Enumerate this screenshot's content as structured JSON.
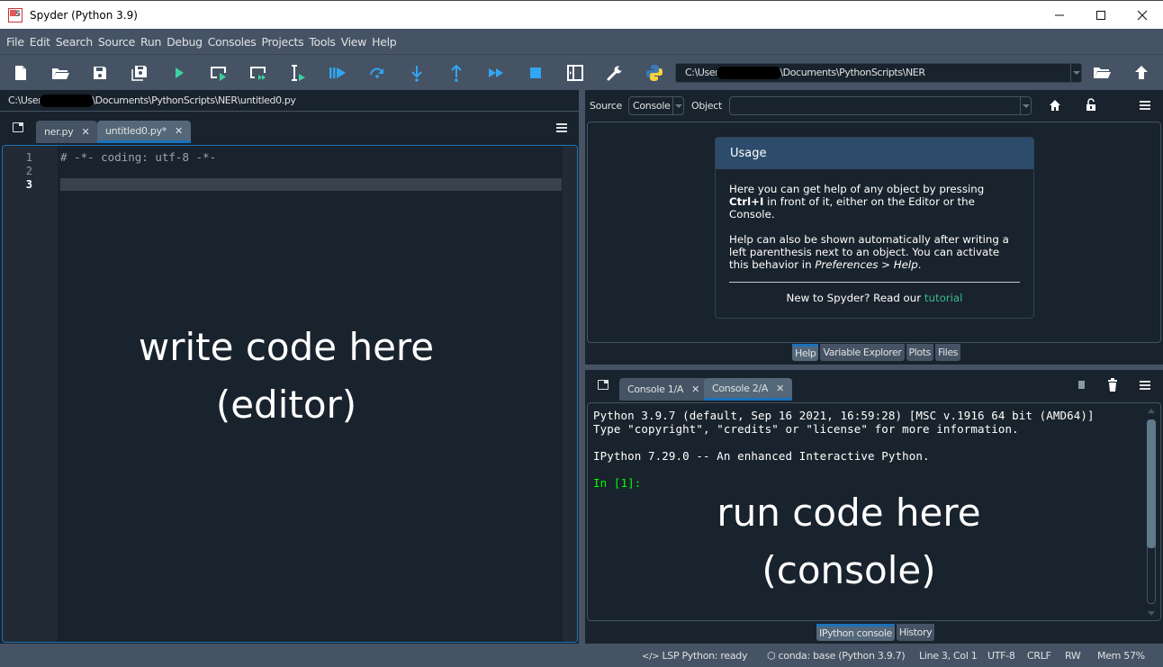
{
  "window": {
    "title": "Spyder (Python 3.9)",
    "controls": [
      "minimize",
      "maximize",
      "close"
    ]
  },
  "menu": [
    "File",
    "Edit",
    "Search",
    "Source",
    "Run",
    "Debug",
    "Consoles",
    "Projects",
    "Tools",
    "View",
    "Help"
  ],
  "toolbar": {
    "buttons": [
      {
        "name": "new-file",
        "icon": "new-file-icon"
      },
      {
        "name": "open-file",
        "icon": "open-folder-icon"
      },
      {
        "name": "save-file",
        "icon": "save-icon"
      },
      {
        "name": "save-all",
        "icon": "save-all-icon"
      },
      {
        "name": "run-file",
        "icon": "run-icon"
      },
      {
        "name": "run-cell",
        "icon": "run-cell-icon"
      },
      {
        "name": "run-cell-advance",
        "icon": "run-cell-advance-icon"
      },
      {
        "name": "run-selection",
        "icon": "run-selection-icon"
      },
      {
        "name": "debug-file",
        "icon": "debug-icon"
      },
      {
        "name": "debug-step-over",
        "icon": "step-over-icon"
      },
      {
        "name": "debug-step-into",
        "icon": "step-into-icon"
      },
      {
        "name": "debug-step-return",
        "icon": "step-return-icon"
      },
      {
        "name": "debug-continue",
        "icon": "continue-icon"
      },
      {
        "name": "debug-stop",
        "icon": "stop-icon"
      },
      {
        "name": "maximize-pane",
        "icon": "maximize-pane-icon"
      },
      {
        "name": "preferences",
        "icon": "wrench-icon"
      },
      {
        "name": "pythonpath-manager",
        "icon": "python-logo-icon"
      }
    ],
    "working_dir_prefix": "C:\\User",
    "working_dir_suffix": "\\Documents\\PythonScripts\\NER",
    "browse_icon": "open-folder-icon",
    "parent_dir_icon": "arrow-up-icon"
  },
  "editor": {
    "path_prefix": "C:\\User",
    "path_suffix": "\\Documents\\PythonScripts\\NER\\untitled0.py",
    "tabs": [
      {
        "label": "ner.py",
        "active": false
      },
      {
        "label": "untitled0.py*",
        "active": true
      }
    ],
    "lines": [
      {
        "no": "1",
        "text": "# -*- coding: utf-8 -*-"
      },
      {
        "no": "2",
        "text": ""
      },
      {
        "no": "3",
        "text": ""
      }
    ],
    "current_line": 3,
    "overlay_line1": "write code here",
    "overlay_line2": "(editor)"
  },
  "help": {
    "source_label": "Source",
    "source_value": "Console",
    "object_label": "Object",
    "object_value": "",
    "usage_title": "Usage",
    "para1_a": "Here you can get help of any object by pressing ",
    "para1_shortcut": "Ctrl+I",
    "para1_b": " in front of it, either on the Editor or the Console.",
    "para2_a": "Help can also be shown automatically after writing a left parenthesis next to an object. You can activate this behavior in ",
    "para2_pref": "Preferences > Help",
    "para2_b": ".",
    "footer_text": "New to Spyder? Read our ",
    "footer_link": "tutorial",
    "tabs": [
      {
        "label": "Help",
        "active": true
      },
      {
        "label": "Variable Explorer",
        "active": false
      },
      {
        "label": "Plots",
        "active": false
      },
      {
        "label": "Files",
        "active": false
      }
    ]
  },
  "console": {
    "tabs": [
      {
        "label": "Console 1/A",
        "active": false
      },
      {
        "label": "Console 2/A",
        "active": true
      }
    ],
    "lines": [
      "Python 3.9.7 (default, Sep 16 2021, 16:59:28) [MSC v.1916 64 bit (AMD64)]",
      "Type \"copyright\", \"credits\" or \"license\" for more information.",
      "IPython 7.29.0 -- An enhanced Interactive Python."
    ],
    "prompt": "In [1]:",
    "overlay_line1": "run code here",
    "overlay_line2": "(console)",
    "bottom_tabs": [
      {
        "label": "IPython console",
        "active": true
      },
      {
        "label": "History",
        "active": false
      }
    ]
  },
  "statusbar": {
    "lsp": "LSP Python: ready",
    "env": "conda: base (Python 3.9.7)",
    "position": "Line 3, Col 1",
    "encoding": "UTF-8",
    "eol": "CRLF",
    "permissions": "RW",
    "memory": "Mem 57%"
  },
  "colors": {
    "accent": "#1a72bb",
    "toolbar_bg": "#455364",
    "pane_bg": "#19232d",
    "run_green": "#3ad3a0",
    "debug_blue": "#31a6f2",
    "prompt_green": "#00ff00",
    "link_green": "#3ab98a"
  }
}
